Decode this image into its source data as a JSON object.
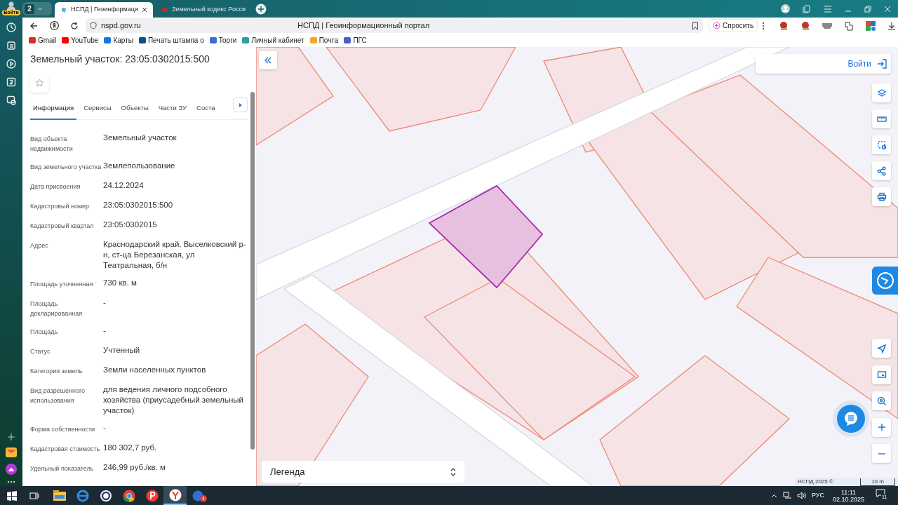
{
  "browser": {
    "profile_badge": "Войти",
    "tab_group_count": "2",
    "tabs": [
      {
        "title": "НСПД | Геоинформаци",
        "selected": true
      },
      {
        "title": "Земельный кодекс Росси",
        "selected": false
      }
    ],
    "address": "nspd.gov.ru",
    "page_title": "НСПД | Геоинформационный портал",
    "ask_button": "Спросить",
    "bookmarks": [
      {
        "label": "Gmail",
        "color": "#d93025"
      },
      {
        "label": "YouTube",
        "color": "#ff0000"
      },
      {
        "label": "Карты",
        "color": "#1a73e8"
      },
      {
        "label": "Печать штампа о",
        "color": "#0d4f8b"
      },
      {
        "label": "Торги",
        "color": "#3b6fd4"
      },
      {
        "label": "Личный кабинет",
        "color": "#2aa0a0"
      },
      {
        "label": "Почта",
        "color": "#f5a623"
      },
      {
        "label": "ПГС",
        "color": "#4a5fc1"
      }
    ]
  },
  "panel": {
    "title": "Земельный участок: 23:05:0302015:500",
    "tabs": [
      {
        "label": "Информация",
        "selected": true
      },
      {
        "label": "Сервисы",
        "selected": false
      },
      {
        "label": "Объекты",
        "selected": false
      },
      {
        "label": "Части ЗУ",
        "selected": false
      },
      {
        "label": "Соста",
        "selected": false
      }
    ],
    "fields": [
      {
        "label": "Вид объекта недвижимости",
        "value": "Земельный участок"
      },
      {
        "label": "Вид земельного участка",
        "value": "Землепользование"
      },
      {
        "label": "Дата присвоения",
        "value": "24.12.2024"
      },
      {
        "label": "Кадастровый номер",
        "value": "23:05:0302015:500"
      },
      {
        "label": "Кадастровый квартал",
        "value": "23:05:0302015"
      },
      {
        "label": "Адрес",
        "value": "Краснодарский край, Выселковский р-н, ст-ца Березанская, ул Театральная, б/н"
      },
      {
        "label": "Площадь уточненная",
        "value": "730 кв. м"
      },
      {
        "label": "Площадь декларированная",
        "value": "-"
      },
      {
        "label": "Площадь",
        "value": "-"
      },
      {
        "label": "Статус",
        "value": "Учтенный"
      },
      {
        "label": "Категория земель",
        "value": "Земли населенных пунктов"
      },
      {
        "label": "Вид разрешенного использования",
        "value": "для ведения личного подсобного хозяйства (приусадебный земельный участок)"
      },
      {
        "label": "Форма собственности",
        "value": "-"
      },
      {
        "label": "Кадастровая стоимость",
        "value": "180 302,7 руб."
      },
      {
        "label": "Удельный показатель",
        "value": "246,99 руб./кв. м"
      }
    ]
  },
  "map": {
    "login_button": "Войти",
    "legend": "Легенда",
    "attribution": "НСПД 2025 ©",
    "scale": "10 m"
  },
  "taskbar": {
    "mail_badge": "4",
    "language": "РУС",
    "time": "11:11",
    "date": "02.10.2025",
    "notifications": "11"
  }
}
